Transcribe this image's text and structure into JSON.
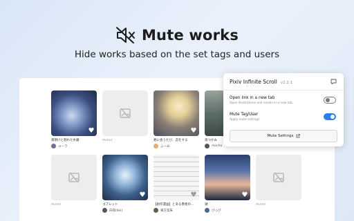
{
  "hero": {
    "title": "Mute works",
    "subtitle": "Hide works based on the set tags and users"
  },
  "grid": {
    "row1": [
      {
        "caption": "夜明けと割れた水鏡",
        "user": "ユーラ",
        "muted": false
      },
      {
        "caption": "Muted",
        "muted": true
      },
      {
        "caption": "君に会うたび、恋をする",
        "user": "ふーみ",
        "muted": false
      },
      {
        "caption": "鳥つかみ",
        "user": "mocha",
        "muted": false
      }
    ],
    "row2": [
      {
        "caption": "Muted",
        "muted": true
      },
      {
        "caption": "ゴブレット",
        "user": "白夜(Kei)",
        "muted": false
      },
      {
        "caption": "【創作漫画】とある勇者の...",
        "user": "東方案朱",
        "muted": false
      },
      {
        "caption": "湖",
        "user": "ぴっぴ",
        "muted": false
      },
      {
        "caption": "Muted",
        "muted": true
      }
    ]
  },
  "popup": {
    "app_name": "Pixiv Infinite Scroll",
    "version": "v2.2.1",
    "open_link": {
      "title": "Open link in a new tab",
      "desc": "Open illustrations and novels in a new tab.",
      "enabled": false
    },
    "mute": {
      "title": "Mute Tag/User",
      "desc": "Apply mute settings.",
      "enabled": true
    },
    "mute_settings_label": "Mute Settings"
  },
  "colors": {
    "accent": "#2b7de9",
    "background": "#e3ecf8"
  }
}
